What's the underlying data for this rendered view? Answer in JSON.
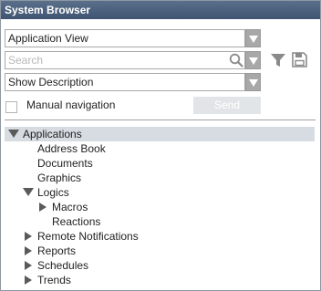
{
  "window": {
    "title": "System Browser"
  },
  "view_select": {
    "value": "Application View"
  },
  "search": {
    "placeholder": "Search",
    "value": ""
  },
  "description_select": {
    "value": "Show Description"
  },
  "manual_navigation": {
    "label": "Manual navigation",
    "checked": false
  },
  "send_button": {
    "label": "Send",
    "enabled": false
  },
  "tree": {
    "root": {
      "label": "Applications",
      "expanded": true,
      "selected": true
    },
    "items": [
      {
        "label": "Address Book"
      },
      {
        "label": "Documents"
      },
      {
        "label": "Graphics"
      },
      {
        "label": "Logics",
        "expanded": true
      },
      {
        "label": "Macros",
        "expanded": false
      },
      {
        "label": "Reactions"
      },
      {
        "label": "Remote Notifications",
        "expanded": false
      },
      {
        "label": "Reports",
        "expanded": false
      },
      {
        "label": "Schedules",
        "expanded": false
      },
      {
        "label": "Trends",
        "expanded": false
      }
    ]
  },
  "icons": {
    "search": "magnifier-icon",
    "search_dropdown": "chevron-down-icon",
    "filter": "filter-funnel-icon",
    "save": "floppy-disk-icon"
  },
  "colors": {
    "titlebar": "#4a5f7c",
    "selection": "#d7dce2",
    "icon_gray": "#8a8a8a",
    "send_disabled": "#e2e5e8"
  }
}
